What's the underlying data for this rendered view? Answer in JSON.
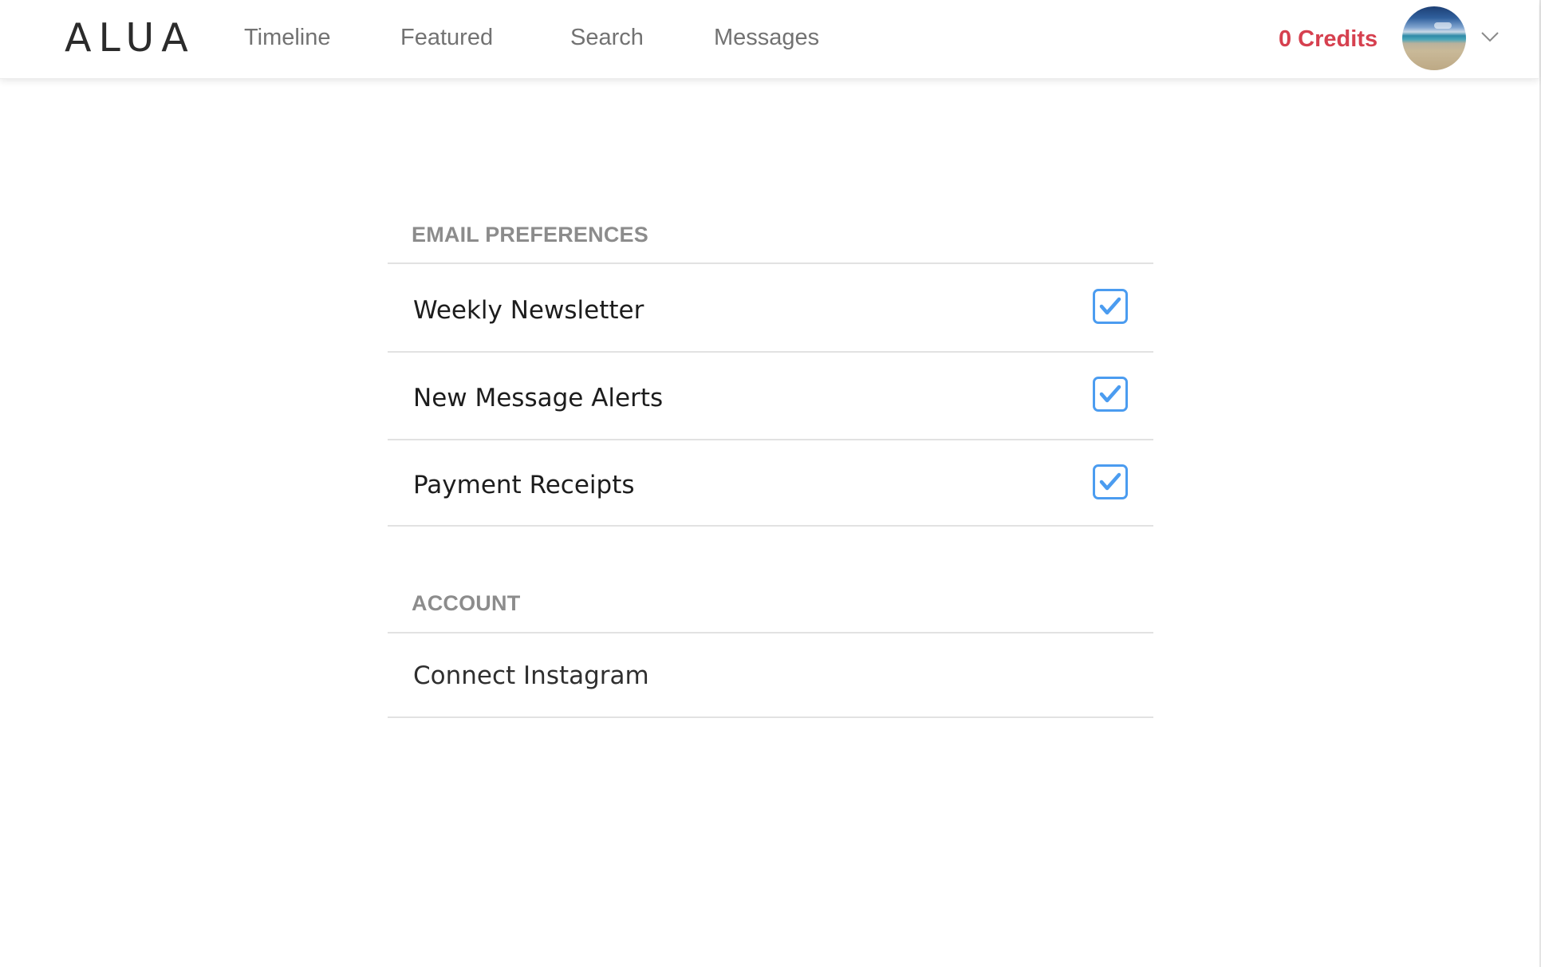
{
  "header": {
    "logo": "ALUA",
    "nav": [
      {
        "label": "Timeline"
      },
      {
        "label": "Featured"
      },
      {
        "label": "Search"
      },
      {
        "label": "Messages"
      }
    ],
    "credits_label": "0 Credits",
    "avatar_icon": "avatar-beach-photo",
    "menu_icon": "chevron-down-icon"
  },
  "email_preferences": {
    "title": "EMAIL PREFERENCES",
    "items": [
      {
        "label": "Weekly Newsletter",
        "checked": true
      },
      {
        "label": "New Message Alerts",
        "checked": true
      },
      {
        "label": "Payment Receipts",
        "checked": true
      }
    ]
  },
  "account": {
    "title": "ACCOUNT",
    "items": [
      {
        "label": "Connect Instagram"
      }
    ]
  },
  "colors": {
    "credits": "#d6404f",
    "checkbox_accent": "#4b9cf0",
    "section_title": "#8c8c8c",
    "nav_text": "#727272"
  }
}
